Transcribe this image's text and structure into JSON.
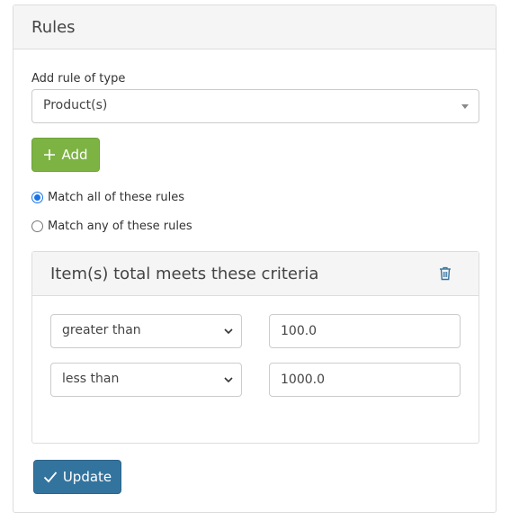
{
  "card": {
    "title": "Rules"
  },
  "rule_type": {
    "label": "Add rule of type",
    "selected": "Product(s)"
  },
  "add_button": {
    "label": "Add",
    "color": "#7cb342"
  },
  "match": {
    "all_label": "Match all of these rules",
    "any_label": "Match any of these rules",
    "selected": "all"
  },
  "rule": {
    "title": "Item(s) total meets these criteria",
    "conditions": [
      {
        "operator": "greater than",
        "value": "100.0"
      },
      {
        "operator": "less than",
        "value": "1000.0"
      }
    ]
  },
  "update_button": {
    "label": "Update",
    "color": "#33749f"
  },
  "icons": {
    "add": "plus-icon",
    "delete": "trash-icon",
    "update": "check-icon",
    "dropdown": "chevron-down-icon"
  }
}
